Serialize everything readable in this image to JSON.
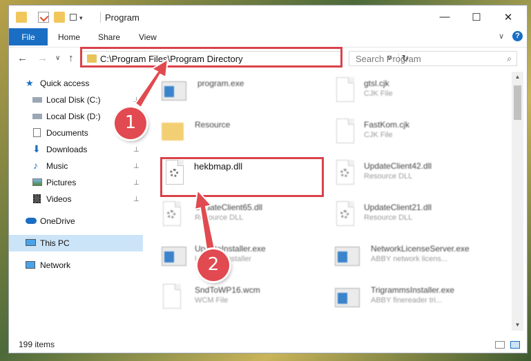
{
  "window": {
    "title": "Program",
    "minimize": "—",
    "maximize": "☐",
    "close": "✕"
  },
  "ribbon": {
    "file": "File",
    "tabs": [
      "Home",
      "Share",
      "View"
    ],
    "collapse": "∨",
    "help": "?"
  },
  "nav": {
    "back": "←",
    "forward": "→",
    "recent": "∨",
    "up": "↑",
    "address": "C:\\Program Files\\Program Directory",
    "address_dropdown": "∨",
    "refresh": "↻",
    "search_placeholder": "Search Program",
    "search_icon": "⌕"
  },
  "sidebar": {
    "items": [
      {
        "label": "Quick access",
        "icon": "star-icon"
      },
      {
        "label": "Local Disk (C:)",
        "icon": "drive-icon",
        "pinned": true
      },
      {
        "label": "Local Disk (D:)",
        "icon": "drive-icon",
        "pinned": true
      },
      {
        "label": "Documents",
        "icon": "documents-icon",
        "pinned": true
      },
      {
        "label": "Downloads",
        "icon": "download-icon",
        "pinned": true
      },
      {
        "label": "Music",
        "icon": "music-icon",
        "pinned": true
      },
      {
        "label": "Pictures",
        "icon": "pictures-icon",
        "pinned": true
      },
      {
        "label": "Videos",
        "icon": "videos-icon",
        "pinned": true
      },
      {
        "label": "OneDrive",
        "icon": "cloud-icon"
      },
      {
        "label": "This PC",
        "icon": "computer-icon",
        "active": true
      },
      {
        "label": "Network",
        "icon": "network-icon"
      }
    ],
    "pin_glyph": "📌"
  },
  "files": [
    {
      "name": "program.exe",
      "type": "",
      "icon": "app-icon"
    },
    {
      "name": "gtsl.cjk",
      "type": "CJK File",
      "icon": "document-icon"
    },
    {
      "name": "Resource",
      "type": "",
      "icon": "folder-icon"
    },
    {
      "name": "FastKom.cjk",
      "type": "CJK File",
      "icon": "document-icon"
    },
    {
      "name": "hekbmap.dll",
      "type": "",
      "icon": "dll-gear-icon"
    },
    {
      "name": "UpdateClient42.dll",
      "type": "Resource DLL",
      "icon": "dll-gear-icon"
    },
    {
      "name": "UpdateClient65.dll",
      "type": "Resource DLL",
      "icon": "dll-gear-icon"
    },
    {
      "name": "UpdateClient21.dll",
      "type": "Resource DLL",
      "icon": "dll-gear-icon"
    },
    {
      "name": "UpdateInstaller.exe",
      "type": "Updates installer",
      "icon": "app-icon"
    },
    {
      "name": "NetworkLicenseServer.exe",
      "type": "ABBY network licens...",
      "icon": "app-icon"
    },
    {
      "name": "SndToWP16.wcm",
      "type": "WCM File",
      "icon": "document-icon"
    },
    {
      "name": "TrigrammsInstaller.exe",
      "type": "ABBY finereader tri...",
      "icon": "app-icon"
    }
  ],
  "status": {
    "items_count": "199 items"
  },
  "annotations": {
    "step1": "1",
    "step2": "2",
    "color": "#d9424a"
  }
}
